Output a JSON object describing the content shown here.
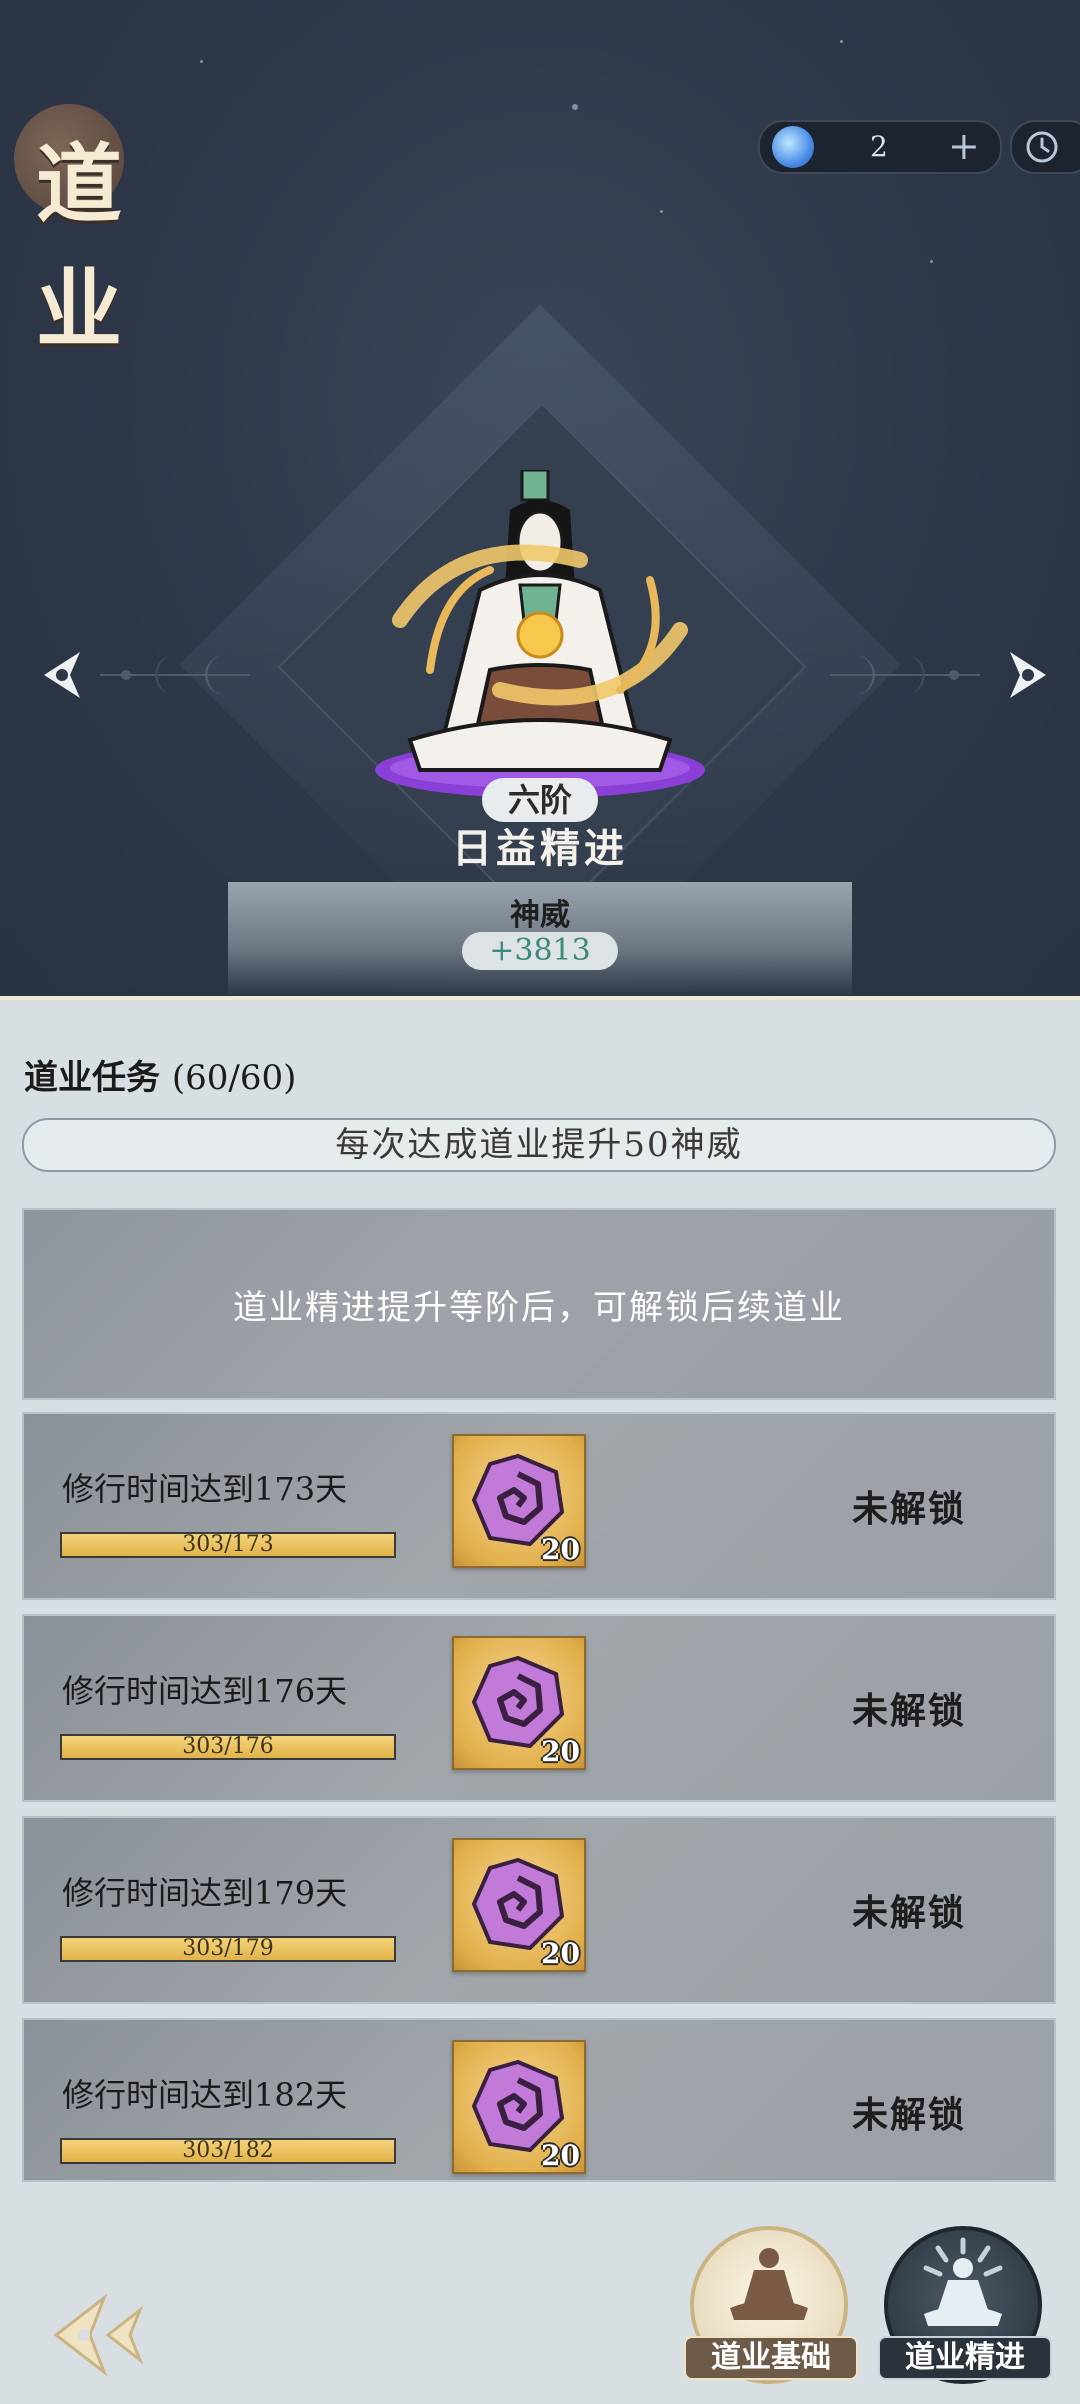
{
  "header": {
    "title": "道业",
    "resource_value": "2",
    "resource_plus": "+",
    "resource_icon": "spirit-orb-icon",
    "clock_icon": "clock-icon"
  },
  "hero": {
    "rank": "六阶",
    "stage_name": "日益精进",
    "power_label": "神威",
    "power_value": "+3813"
  },
  "tasks": {
    "title": "道业任务",
    "count": "(60/60)",
    "rule": "每次达成道业提升50神威",
    "locked_message": "道业精进提升等阶后，可解锁后续道业",
    "items": [
      {
        "desc": "修行时间达到173天",
        "progress_text": "303/173",
        "progress": 1.0,
        "reward_qty": "20",
        "status": "未解锁"
      },
      {
        "desc": "修行时间达到176天",
        "progress_text": "303/176",
        "progress": 1.0,
        "reward_qty": "20",
        "status": "未解锁"
      },
      {
        "desc": "修行时间达到179天",
        "progress_text": "303/179",
        "progress": 1.0,
        "reward_qty": "20",
        "status": "未解锁"
      },
      {
        "desc": "修行时间达到182天",
        "progress_text": "303/182",
        "progress": 1.0,
        "reward_qty": "20",
        "status": "未解锁"
      }
    ]
  },
  "bottom_nav": {
    "basic_label": "道业基础",
    "advance_label": "道业精进"
  },
  "colors": {
    "accent_gold": "#e2b34a",
    "power_green": "#3e8a78",
    "aura_purple": "#8a3fd6"
  }
}
